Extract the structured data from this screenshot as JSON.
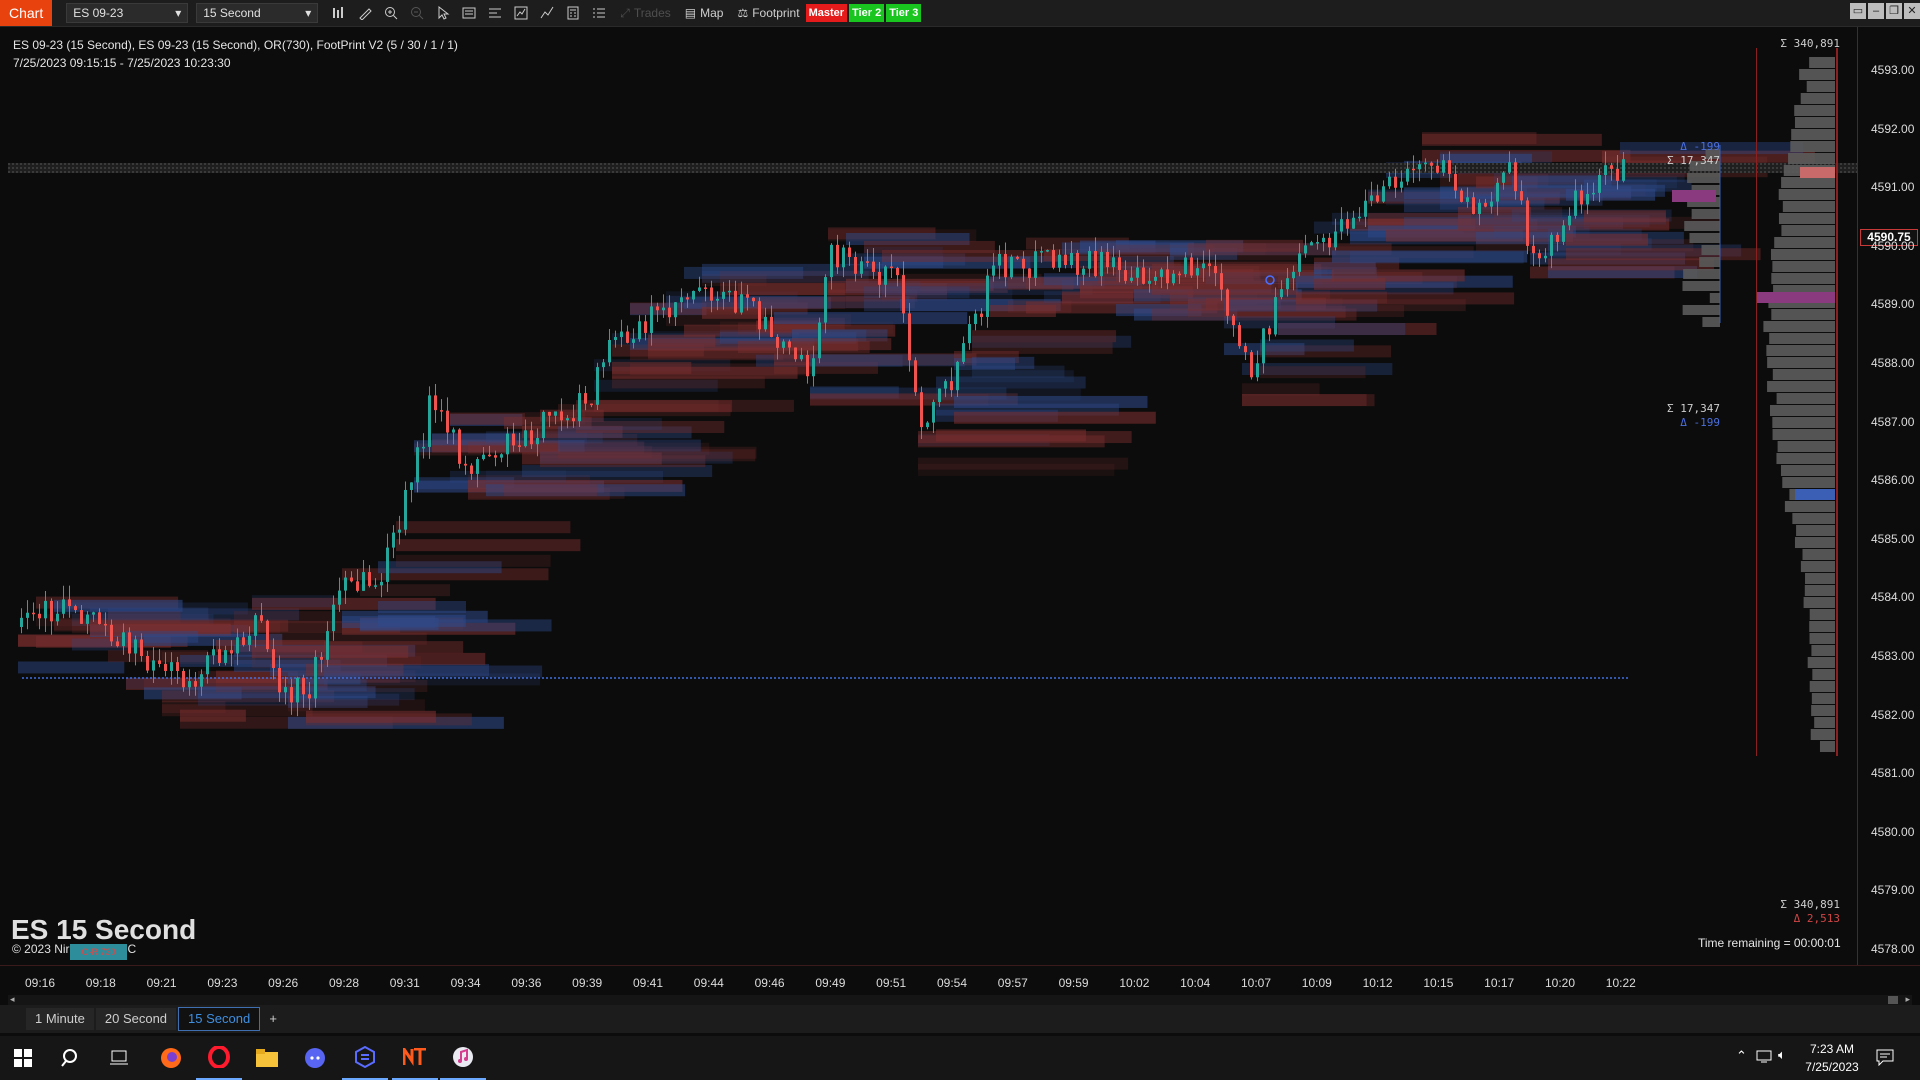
{
  "toolbar": {
    "chart_menu": "Chart",
    "instrument": "ES 09-23",
    "interval": "15 Second",
    "trades_label": "Trades",
    "map_label": "Map",
    "footprint_label": "Footprint",
    "master_label": "Master",
    "tier2_label": "Tier 2",
    "tier3_label": "Tier 3"
  },
  "chart_info": {
    "line1": "ES 09-23 (15 Second), ES 09-23 (15 Second), OR(730), FootPrint V2 (5 / 30 / 1 / 1)",
    "line2": "7/25/2023 09:15:15 - 7/25/2023 10:23:30",
    "watermark": "ES 15 Second",
    "copyright": "© 2023 Nir",
    "copyright_suffix": "C",
    "or_tag": "O-R 730",
    "time_remaining": "Time remaining = 00:00:01"
  },
  "footprint_labels": {
    "top_sigma": "Σ 340,891",
    "box_delta_top": "Δ -199",
    "box_sigma_top": "Σ 17,347",
    "box_sigma_bottom": "Σ 17,347",
    "box_delta_bottom": "Δ -199",
    "bottom_sigma": "Σ 340,891",
    "bottom_delta": "Δ 2,513"
  },
  "price_axis": {
    "ticks": [
      "4593.00",
      "4592.00",
      "4591.00",
      "4590.00",
      "4589.00",
      "4588.00",
      "4587.00",
      "4586.00",
      "4585.00",
      "4584.00",
      "4583.00",
      "4582.00",
      "4581.00",
      "4580.00",
      "4579.00",
      "4578.00"
    ],
    "current_price": "4590.75"
  },
  "time_axis": {
    "ticks": [
      "09:16",
      "09:18",
      "09:21",
      "09:23",
      "09:26",
      "09:28",
      "09:31",
      "09:34",
      "09:36",
      "09:39",
      "09:41",
      "09:44",
      "09:46",
      "09:49",
      "09:51",
      "09:54",
      "09:57",
      "09:59",
      "10:02",
      "10:04",
      "10:07",
      "10:09",
      "10:12",
      "10:15",
      "10:17",
      "10:20",
      "10:22"
    ]
  },
  "tabs": [
    "1 Minute",
    "20 Second",
    "15 Second"
  ],
  "active_tab": "15 Second",
  "taskbar": {
    "time": "7:23 AM",
    "date": "7/25/2023"
  },
  "colors": {
    "up": "#26a69a",
    "down": "#ef5350",
    "bid_heat": "#2e4a8a",
    "ask_heat": "#7a2e2e",
    "accent": "#e8430f",
    "tier_green": "#19c51f",
    "master_red": "#e51b1b"
  }
}
